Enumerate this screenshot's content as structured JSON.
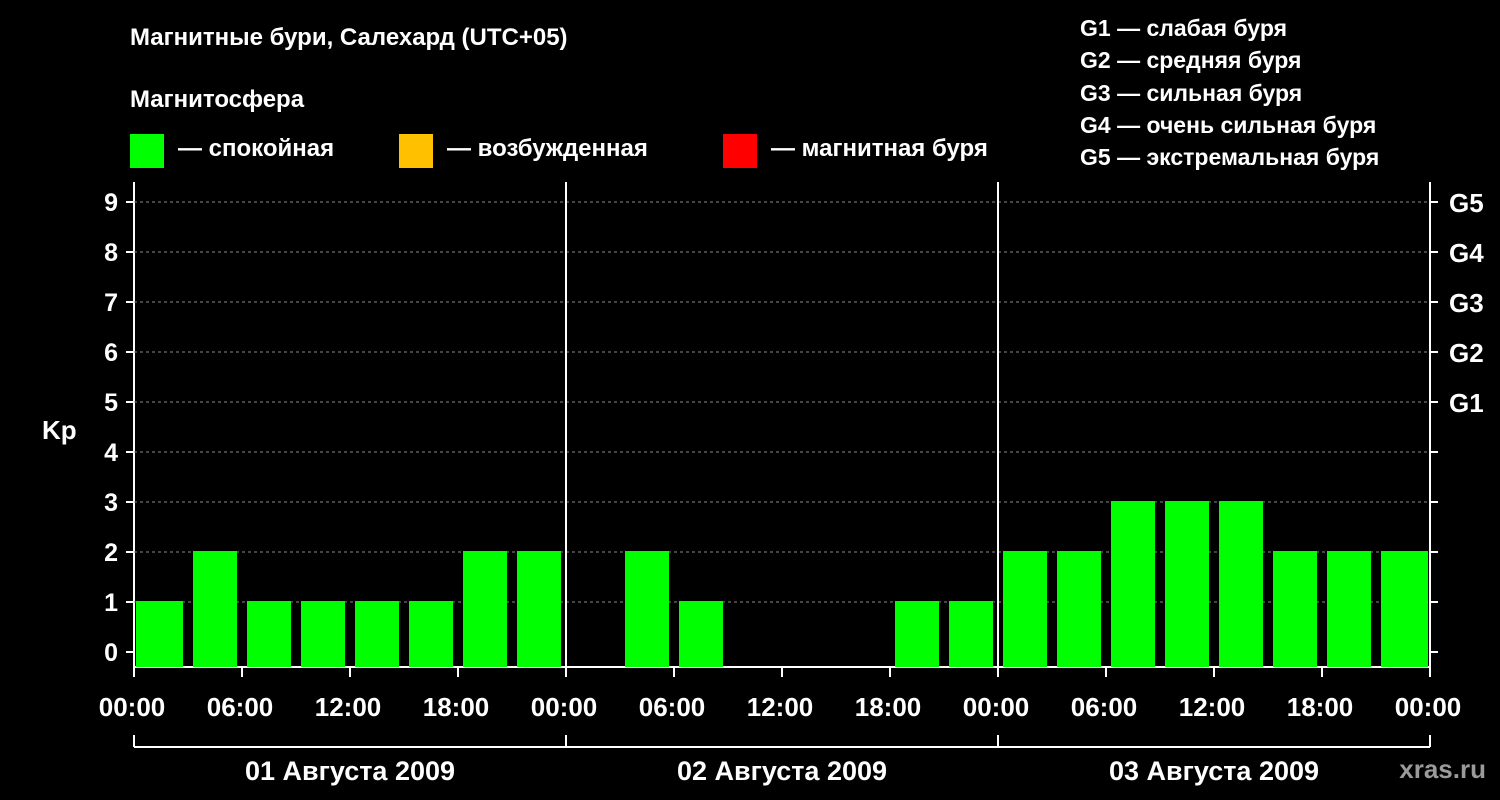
{
  "title": "Магнитные бури, Салехард (UTC+05)",
  "legend": {
    "heading": "Магнитосфера",
    "items": [
      {
        "label": "— спокойная",
        "color": "#00ff00"
      },
      {
        "label": "— возбужденная",
        "color": "#ffc000"
      },
      {
        "label": "— магнитная буря",
        "color": "#ff0000"
      }
    ]
  },
  "g_scale": [
    "G1 — слабая буря",
    "G2 — средняя буря",
    "G3 — сильная буря",
    "G4 — очень сильная буря",
    "G5 — экстремальная буря"
  ],
  "watermark": "xras.ru",
  "chart_data": {
    "type": "bar",
    "ylabel": "Kp",
    "ylim": [
      0,
      9
    ],
    "yticks": [
      "0",
      "1",
      "2",
      "3",
      "4",
      "5",
      "6",
      "7",
      "8",
      "9"
    ],
    "right_axis_labels": [
      {
        "kp": 5,
        "label": "G1"
      },
      {
        "kp": 6,
        "label": "G2"
      },
      {
        "kp": 7,
        "label": "G3"
      },
      {
        "kp": 8,
        "label": "G4"
      },
      {
        "kp": 9,
        "label": "G5"
      }
    ],
    "xtick_labels": [
      "00:00",
      "06:00",
      "12:00",
      "18:00",
      "00:00",
      "06:00",
      "12:00",
      "18:00",
      "00:00",
      "06:00",
      "12:00",
      "18:00",
      "00:00"
    ],
    "days": [
      "01 Августа 2009",
      "02 Августа 2009",
      "03 Августа 2009"
    ],
    "bar_color": "#00ff00",
    "grid": "dashed horizontal",
    "values": [
      1,
      2,
      1,
      1,
      1,
      1,
      2,
      2,
      0,
      2,
      1,
      0,
      0,
      0,
      1,
      1,
      2,
      2,
      3,
      3,
      3,
      2,
      2,
      2
    ]
  }
}
